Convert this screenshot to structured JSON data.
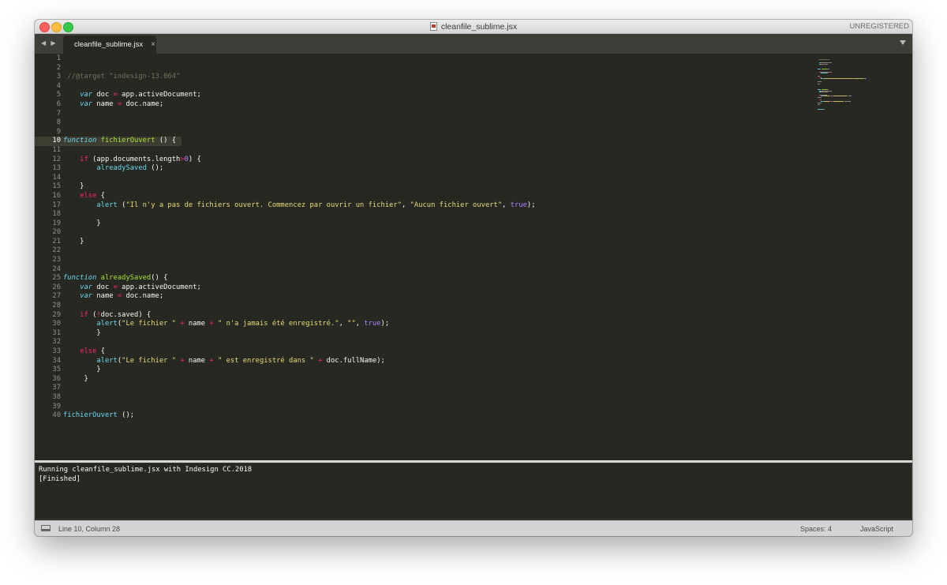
{
  "window": {
    "title": "cleanfile_sublime.jsx",
    "license_label": "UNREGISTERED"
  },
  "tabs": [
    {
      "label": "cleanfile_sublime.jsx",
      "close": "×"
    }
  ],
  "editor": {
    "active_line": 10,
    "lines": [
      {
        "n": "1",
        "tokens": []
      },
      {
        "n": "2",
        "tokens": []
      },
      {
        "n": "3",
        "tokens": [
          [
            "",
            " "
          ],
          [
            "cm",
            "//@target \"indesign-13.064\""
          ]
        ]
      },
      {
        "n": "4",
        "tokens": []
      },
      {
        "n": "5",
        "tokens": [
          [
            "",
            "    "
          ],
          [
            "kw",
            "var"
          ],
          [
            "",
            " doc "
          ],
          [
            "op",
            "="
          ],
          [
            "",
            " app.activeDocument;"
          ]
        ]
      },
      {
        "n": "6",
        "tokens": [
          [
            "",
            "    "
          ],
          [
            "kw",
            "var"
          ],
          [
            "",
            " name "
          ],
          [
            "op",
            "="
          ],
          [
            "",
            " doc.name;"
          ]
        ]
      },
      {
        "n": "7",
        "tokens": []
      },
      {
        "n": "8",
        "tokens": []
      },
      {
        "n": "9",
        "tokens": []
      },
      {
        "n": "10",
        "tokens": [
          [
            "kw",
            "function"
          ],
          [
            "",
            " "
          ],
          [
            "fn",
            "fichierOuvert"
          ],
          [
            "",
            " () {"
          ]
        ]
      },
      {
        "n": "11",
        "tokens": []
      },
      {
        "n": "12",
        "tokens": [
          [
            "",
            "    "
          ],
          [
            "op",
            "if"
          ],
          [
            "",
            " (app.documents.length"
          ],
          [
            "op",
            ">"
          ],
          [
            "num",
            "0"
          ],
          [
            "",
            ") {"
          ]
        ]
      },
      {
        "n": "13",
        "tokens": [
          [
            "",
            "        "
          ],
          [
            "call",
            "alreadySaved"
          ],
          [
            "",
            " ();"
          ]
        ]
      },
      {
        "n": "14",
        "tokens": []
      },
      {
        "n": "15",
        "tokens": [
          [
            "",
            "    }"
          ]
        ]
      },
      {
        "n": "16",
        "tokens": [
          [
            "",
            "    "
          ],
          [
            "op",
            "else"
          ],
          [
            "",
            " {"
          ]
        ]
      },
      {
        "n": "17",
        "tokens": [
          [
            "",
            "        "
          ],
          [
            "call",
            "alert"
          ],
          [
            "",
            " ("
          ],
          [
            "str",
            "\"Il n'y a pas de fichiers ouvert. Commencez par ouvrir un fichier\""
          ],
          [
            "",
            ", "
          ],
          [
            "str",
            "\"Aucun fichier ouvert\""
          ],
          [
            "",
            ", "
          ],
          [
            "num",
            "true"
          ],
          [
            "",
            ");"
          ]
        ]
      },
      {
        "n": "18",
        "tokens": []
      },
      {
        "n": "19",
        "tokens": [
          [
            "",
            "        }"
          ]
        ]
      },
      {
        "n": "20",
        "tokens": []
      },
      {
        "n": "21",
        "tokens": [
          [
            "",
            "    }"
          ]
        ]
      },
      {
        "n": "22",
        "tokens": []
      },
      {
        "n": "23",
        "tokens": []
      },
      {
        "n": "24",
        "tokens": []
      },
      {
        "n": "25",
        "tokens": [
          [
            "kw",
            "function"
          ],
          [
            "",
            " "
          ],
          [
            "fn",
            "alreadySaved"
          ],
          [
            "",
            "() {"
          ]
        ]
      },
      {
        "n": "26",
        "tokens": [
          [
            "",
            "    "
          ],
          [
            "kw",
            "var"
          ],
          [
            "",
            " doc "
          ],
          [
            "op",
            "="
          ],
          [
            "",
            " app.activeDocument;"
          ]
        ]
      },
      {
        "n": "27",
        "tokens": [
          [
            "",
            "    "
          ],
          [
            "kw",
            "var"
          ],
          [
            "",
            " name "
          ],
          [
            "op",
            "="
          ],
          [
            "",
            " doc.name;"
          ]
        ]
      },
      {
        "n": "28",
        "tokens": []
      },
      {
        "n": "29",
        "tokens": [
          [
            "",
            "    "
          ],
          [
            "op",
            "if"
          ],
          [
            "",
            " ("
          ],
          [
            "op",
            "!"
          ],
          [
            "",
            "doc.saved) {"
          ]
        ]
      },
      {
        "n": "30",
        "tokens": [
          [
            "",
            "        "
          ],
          [
            "call",
            "alert"
          ],
          [
            "",
            "("
          ],
          [
            "str",
            "\"Le fichier \""
          ],
          [
            "",
            " "
          ],
          [
            "op",
            "+"
          ],
          [
            "",
            " name "
          ],
          [
            "op",
            "+"
          ],
          [
            "",
            " "
          ],
          [
            "str",
            "\" n'a jamais été enregistré.\""
          ],
          [
            "",
            ", "
          ],
          [
            "str",
            "\"\""
          ],
          [
            "",
            ", "
          ],
          [
            "num",
            "true"
          ],
          [
            "",
            ");"
          ]
        ]
      },
      {
        "n": "31",
        "tokens": [
          [
            "",
            "        }"
          ]
        ]
      },
      {
        "n": "32",
        "tokens": []
      },
      {
        "n": "33",
        "tokens": [
          [
            "",
            "    "
          ],
          [
            "op",
            "else"
          ],
          [
            "",
            " {"
          ]
        ]
      },
      {
        "n": "34",
        "tokens": [
          [
            "",
            "        "
          ],
          [
            "call",
            "alert"
          ],
          [
            "",
            "("
          ],
          [
            "str",
            "\"Le fichier \""
          ],
          [
            "",
            " "
          ],
          [
            "op",
            "+"
          ],
          [
            "",
            " name "
          ],
          [
            "op",
            "+"
          ],
          [
            "",
            " "
          ],
          [
            "str",
            "\" est enregistré dans \""
          ],
          [
            "",
            " "
          ],
          [
            "op",
            "+"
          ],
          [
            "",
            " doc.fullName);"
          ]
        ]
      },
      {
        "n": "35",
        "tokens": [
          [
            "",
            "        }"
          ]
        ]
      },
      {
        "n": "36",
        "tokens": [
          [
            "",
            "     }"
          ]
        ]
      },
      {
        "n": "37",
        "tokens": []
      },
      {
        "n": "38",
        "tokens": []
      },
      {
        "n": "39",
        "tokens": []
      },
      {
        "n": "40",
        "tokens": [
          [
            "call",
            "fichierOuvert"
          ],
          [
            "",
            " ();"
          ]
        ]
      }
    ]
  },
  "console": {
    "lines": [
      "Running cleanfile_sublime.jsx with Indesign CC.2018",
      "[Finished]"
    ]
  },
  "status": {
    "position": "Line 10, Column 28",
    "spaces": "Spaces: 4",
    "syntax": "JavaScript"
  },
  "colors": {
    "background": "#272822",
    "keyword": "#66d9ef",
    "function": "#a6e22e",
    "operator": "#f92672",
    "string": "#e6db74",
    "number": "#ae81ff",
    "comment": "#75715e"
  }
}
